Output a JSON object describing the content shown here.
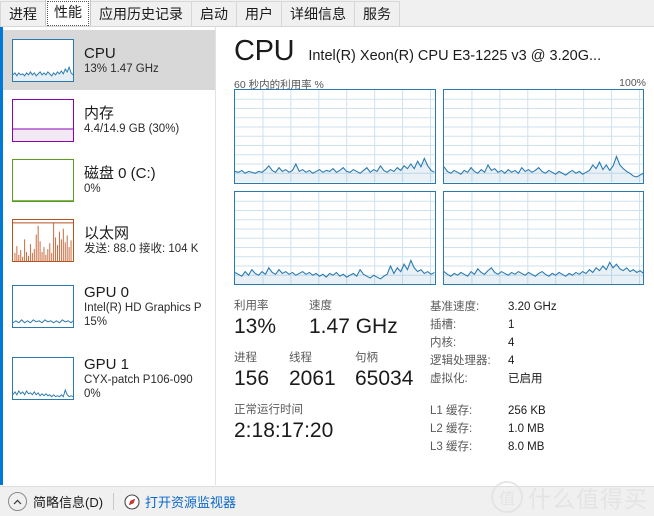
{
  "tabs": [
    {
      "label": "进程",
      "active": false
    },
    {
      "label": "性能",
      "active": true
    },
    {
      "label": "应用历史记录",
      "active": false
    },
    {
      "label": "启动",
      "active": false
    },
    {
      "label": "用户",
      "active": false
    },
    {
      "label": "详细信息",
      "active": false
    },
    {
      "label": "服务",
      "active": false
    }
  ],
  "sidebar": {
    "items": [
      {
        "name": "cpu",
        "title": "CPU",
        "sub1": "13% 1.47 GHz",
        "sub2": "",
        "selected": true,
        "color": "#2a7ab0",
        "thumb": "line"
      },
      {
        "name": "memory",
        "title": "内存",
        "sub1": "4.4/14.9 GB (30%)",
        "sub2": "",
        "selected": false,
        "color": "#8b00b5",
        "thumb": "fill",
        "fill_pct": 30
      },
      {
        "name": "disk-0",
        "title": "磁盘 0 (C:)",
        "sub1": "0%",
        "sub2": "",
        "selected": false,
        "color": "#5a9e1f",
        "thumb": "flat"
      },
      {
        "name": "ethernet",
        "title": "以太网",
        "sub1": "发送: 88.0 接收: 104 K",
        "sub2": "",
        "selected": false,
        "color": "#b5521e",
        "thumb": "spikes"
      },
      {
        "name": "gpu-0",
        "title": "GPU 0",
        "sub1": "Intel(R) HD Graphics P",
        "sub2": "15%",
        "selected": false,
        "color": "#2a7ab0",
        "thumb": "line"
      },
      {
        "name": "gpu-1",
        "title": "GPU 1",
        "sub1": "CYX-patch P106-090",
        "sub2": "0%",
        "selected": false,
        "color": "#2a7ab0",
        "thumb": "line"
      }
    ]
  },
  "main": {
    "title": "CPU",
    "subtitle": "Intel(R) Xeon(R) CPU E3-1225 v3 @ 3.20G...",
    "graph_axis_left": "60 秒内的利用率 %",
    "graph_axis_right": "100%",
    "stats": {
      "utilization_label": "利用率",
      "utilization_value": "13%",
      "speed_label": "速度",
      "speed_value": "1.47 GHz",
      "processes_label": "进程",
      "processes_value": "156",
      "threads_label": "线程",
      "threads_value": "2061",
      "handles_label": "句柄",
      "handles_value": "65034",
      "uptime_label": "正常运行时间",
      "uptime_value": "2:18:17:20"
    },
    "details": [
      {
        "label": "基准速度:",
        "value": "3.20 GHz"
      },
      {
        "label": "插槽:",
        "value": "1"
      },
      {
        "label": "内核:",
        "value": "4"
      },
      {
        "label": "逻辑处理器:",
        "value": "4"
      },
      {
        "label": "虚拟化:",
        "value": "已启用"
      }
    ],
    "caches": [
      {
        "label": "L1 缓存:",
        "value": "256 KB"
      },
      {
        "label": "L2 缓存:",
        "value": "1.0 MB"
      },
      {
        "label": "L3 缓存:",
        "value": "8.0 MB"
      }
    ]
  },
  "chart_data": {
    "type": "line",
    "title": "60 秒内的利用率 %",
    "xlabel": "60 秒内的利用率 %",
    "ylabel": "%",
    "ylim": [
      0,
      100
    ],
    "grid": true,
    "legend": null,
    "panels": [
      {
        "name": "cpu-core-0",
        "values": [
          12,
          11,
          13,
          10,
          12,
          11,
          10,
          12,
          11,
          14,
          18,
          13,
          11,
          16,
          12,
          14,
          11,
          13,
          20,
          12,
          14,
          11,
          13,
          10,
          12,
          14,
          11,
          13,
          12,
          15,
          11,
          13,
          16,
          12,
          11,
          14,
          12,
          10,
          13,
          16,
          11,
          14,
          12,
          18,
          13,
          11,
          14,
          12,
          16,
          13,
          18,
          15,
          20,
          16,
          23,
          17,
          26,
          18,
          13,
          11
        ]
      },
      {
        "name": "cpu-core-1",
        "values": [
          17,
          12,
          10,
          13,
          11,
          9,
          13,
          11,
          16,
          12,
          10,
          14,
          11,
          19,
          13,
          15,
          11,
          13,
          10,
          14,
          12,
          11,
          13,
          10,
          16,
          12,
          14,
          11,
          13,
          16,
          12,
          10,
          13,
          11,
          9,
          12,
          10,
          8,
          11,
          13,
          10,
          12,
          9,
          11,
          13,
          19,
          15,
          22,
          14,
          19,
          13,
          18,
          28,
          19,
          15,
          12,
          10,
          9,
          7,
          6
        ]
      },
      {
        "name": "cpu-core-2",
        "values": [
          13,
          11,
          9,
          14,
          10,
          16,
          12,
          10,
          14,
          11,
          18,
          13,
          11,
          16,
          12,
          14,
          11,
          13,
          10,
          12,
          14,
          11,
          13,
          10,
          12,
          9,
          11,
          8,
          12,
          10,
          13,
          9,
          11,
          8,
          10,
          12,
          9,
          16,
          11,
          9,
          7,
          10,
          8,
          6,
          9,
          11,
          20,
          12,
          18,
          14,
          22,
          16,
          26,
          18,
          14,
          16,
          12,
          14,
          11,
          13
        ]
      },
      {
        "name": "cpu-core-3",
        "values": [
          14,
          11,
          9,
          12,
          10,
          13,
          11,
          9,
          14,
          11,
          17,
          13,
          11,
          15,
          18,
          13,
          11,
          14,
          12,
          10,
          13,
          11,
          14,
          12,
          10,
          13,
          11,
          9,
          12,
          14,
          11,
          9,
          12,
          10,
          13,
          11,
          9,
          12,
          10,
          13,
          11,
          14,
          12,
          16,
          13,
          18,
          15,
          20,
          16,
          24,
          18,
          22,
          17,
          15,
          18,
          14,
          16,
          13,
          15,
          12
        ]
      }
    ]
  },
  "statusbar": {
    "collapse_label": "简略信息(D)",
    "resource_monitor_label": "打开资源监视器"
  },
  "watermark": {
    "badge": "值",
    "text": "什么值得买"
  }
}
